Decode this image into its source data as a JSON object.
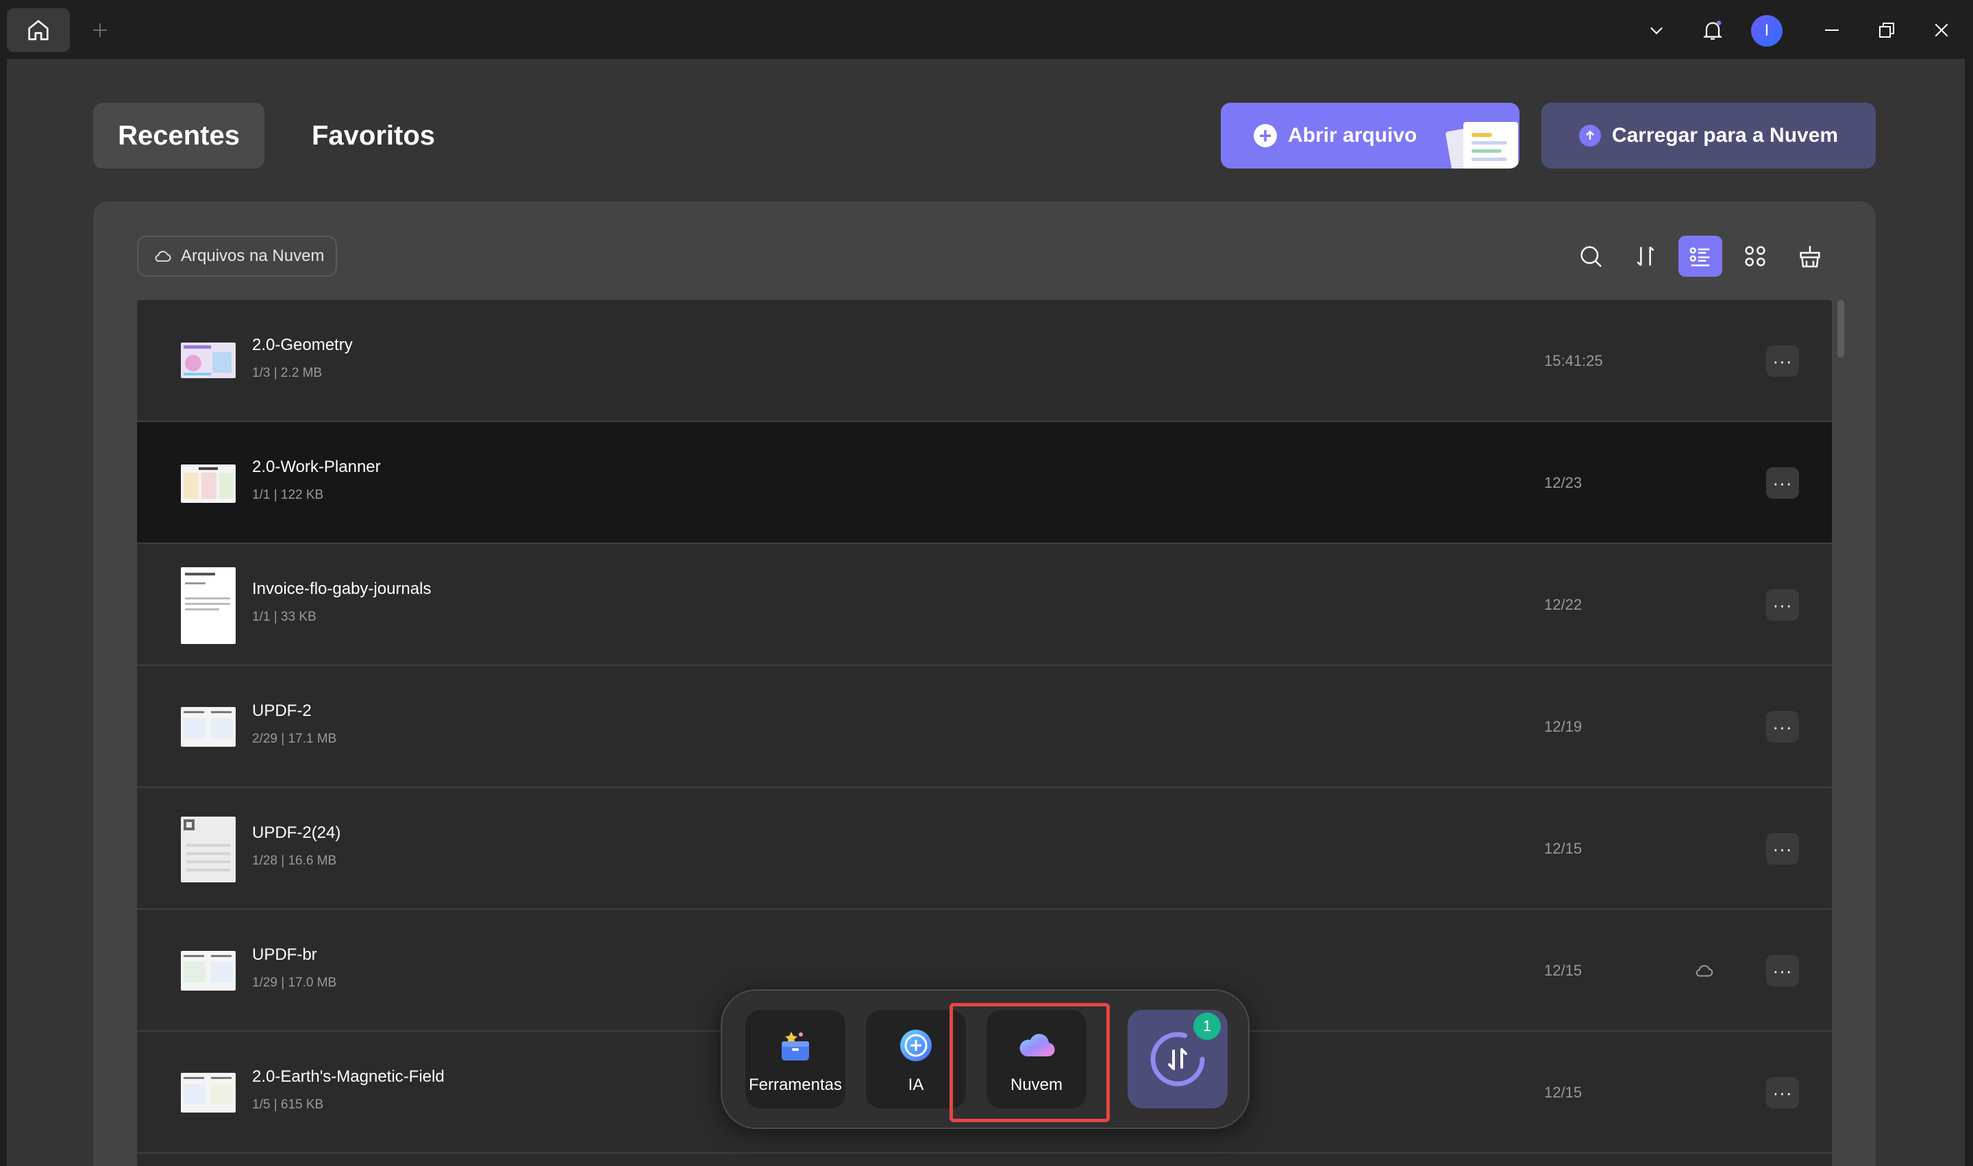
{
  "titlebar": {
    "home_icon": "home-icon",
    "new_tab_icon": "plus-icon",
    "avatar_initial": "I",
    "icons": [
      "chevron-down-icon",
      "bell-icon",
      "minimize-icon",
      "restore-icon",
      "close-icon"
    ]
  },
  "tabs": {
    "recent": "Recentes",
    "favorites": "Favoritos"
  },
  "actions": {
    "open_file": "Abrir arquivo",
    "upload_cloud": "Carregar para a Nuvem"
  },
  "filter": {
    "cloud_files": "Arquivos na Nuvem"
  },
  "toolbar": {
    "icons": [
      "search-icon",
      "sort-icon",
      "list-view-icon",
      "grid-view-icon",
      "clean-icon"
    ],
    "active_view": "list"
  },
  "files": [
    {
      "name": "2.0-Geometry",
      "meta": "1/3 | 2.2 MB",
      "date": "15:41:25",
      "cloud": false
    },
    {
      "name": "2.0-Work-Planner",
      "meta": "1/1 | 122 KB",
      "date": "12/23",
      "cloud": false
    },
    {
      "name": "Invoice-flo-gaby-journals",
      "meta": "1/1 | 33 KB",
      "date": "12/22",
      "cloud": false
    },
    {
      "name": "UPDF-2",
      "meta": "2/29 | 17.1 MB",
      "date": "12/19",
      "cloud": false
    },
    {
      "name": "UPDF-2(24)",
      "meta": "1/28 | 16.6 MB",
      "date": "12/15",
      "cloud": false
    },
    {
      "name": "UPDF-br",
      "meta": "1/29 | 17.0 MB",
      "date": "12/15",
      "cloud": true
    },
    {
      "name": "2.0-Earth's-Magnetic-Field",
      "meta": "1/5 | 615 KB",
      "date": "12/15",
      "cloud": false
    }
  ],
  "more_label": "···",
  "dock": {
    "tools": "Ferramentas",
    "ai": "IA",
    "cloud": "Nuvem",
    "sync_badge": "1"
  },
  "colors": {
    "accent": "#7d78f5",
    "highlight_box": "#e64646",
    "badge": "#19b78c"
  }
}
